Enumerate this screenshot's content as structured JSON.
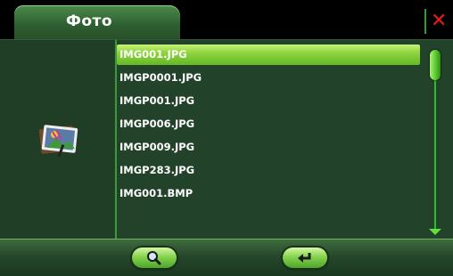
{
  "window": {
    "title": "Фото",
    "close_icon": "✕"
  },
  "files": [
    {
      "name": "IMG001.JPG",
      "selected": true
    },
    {
      "name": "IMGP0001.JPG",
      "selected": false
    },
    {
      "name": "IMGP001.JPG",
      "selected": false
    },
    {
      "name": "IMGP006.JPG",
      "selected": false
    },
    {
      "name": "IMGP009.JPG",
      "selected": false
    },
    {
      "name": "IMGP283.JPG",
      "selected": false
    },
    {
      "name": "IMG001.BMP",
      "selected": false
    }
  ],
  "icons": {
    "photo": "photo-icon",
    "search": "magnifier-icon",
    "back": "return-arrow-icon",
    "scroll_down": "down-arrow-icon"
  },
  "colors": {
    "accent_green": "#8fd43d",
    "close_red": "#e41c1c",
    "panel_green": "#23422a"
  }
}
